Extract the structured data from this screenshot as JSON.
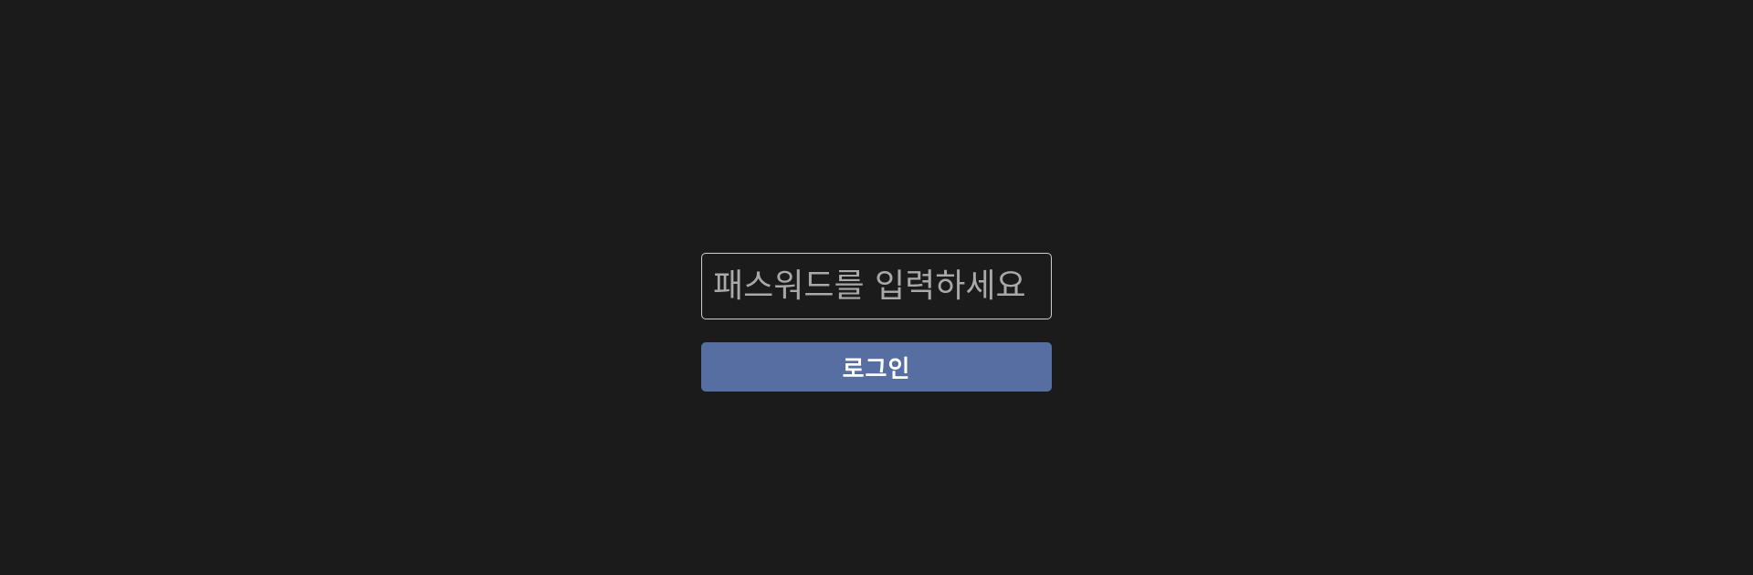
{
  "login": {
    "password_placeholder": "패스워드를 입력하세요",
    "password_value": "",
    "login_label": "로그인"
  },
  "colors": {
    "background": "#1b1b1b",
    "field_border": "#cfcfcf",
    "placeholder_text": "#a9a9a9",
    "button_background": "#566ea2",
    "button_text": "#ffffff"
  }
}
